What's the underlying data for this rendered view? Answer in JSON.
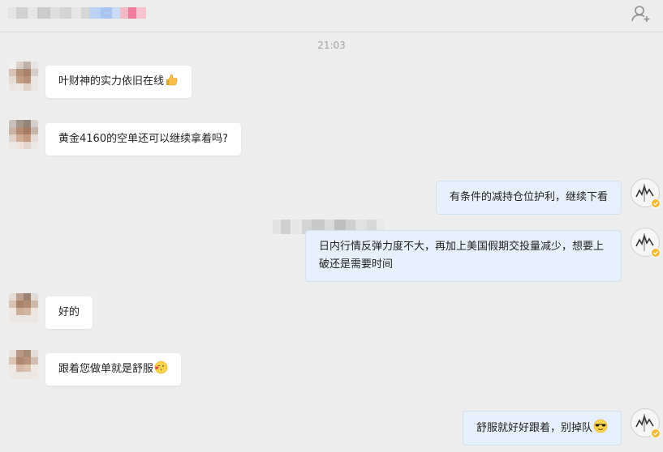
{
  "chat": {
    "timestamp": "21:03",
    "messages": [
      {
        "from": "other",
        "text": "叶财神的实力依旧在线"
      },
      {
        "from": "other",
        "text": "黄金4160的空单还可以继续拿着吗?"
      },
      {
        "from": "me",
        "text": "有条件的减持仓位护利，继续下看"
      },
      {
        "from": "me",
        "text": "日内行情反弹力度不大，再加上美国假期交投量减少，想要上破还是需要时间"
      },
      {
        "from": "other",
        "text": "好的"
      },
      {
        "from": "other",
        "text": "跟着您做单就是舒服"
      },
      {
        "from": "me",
        "text": "舒服就好好跟着，别掉队"
      }
    ]
  },
  "colors": {
    "background": "#ededed",
    "incoming_bubble": "#ffffff",
    "outgoing_bubble": "#e6f0fa",
    "timestamp": "#a3a3a3"
  },
  "icons": {
    "header_action": "add-user-icon",
    "emoji_1": "thumbs-up-emoji",
    "emoji_2": "kiss-emoji",
    "emoji_3": "sunglasses-emoji"
  }
}
